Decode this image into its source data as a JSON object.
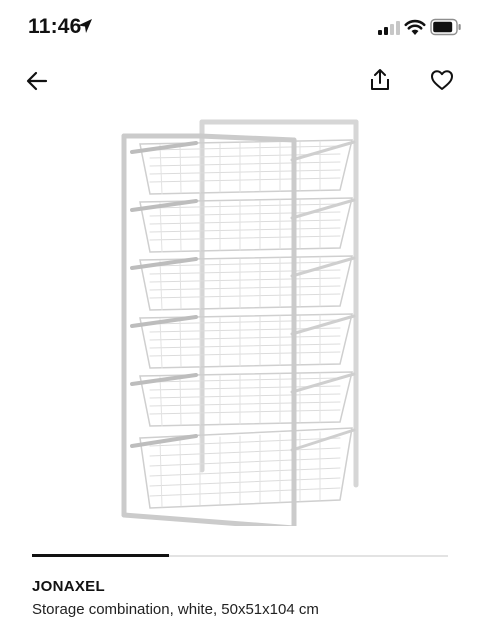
{
  "status_bar": {
    "time": "11:46",
    "icons": [
      "location-arrow-icon",
      "cellular-signal-icon",
      "wifi-icon",
      "battery-icon"
    ]
  },
  "nav": {
    "back_icon": "arrow-left-icon",
    "share_icon": "share-icon",
    "favorite_icon": "heart-icon"
  },
  "product_image": {
    "description_icon": "wire-basket-storage-unit"
  },
  "carousel": {
    "progress": 0.33
  },
  "product": {
    "name": "JONAXEL",
    "description": "Storage combination, white, 50x51x104 cm"
  },
  "colors": {
    "text": "#111111",
    "progress_track": "#e3e3e3",
    "progress_fill": "#111111"
  }
}
